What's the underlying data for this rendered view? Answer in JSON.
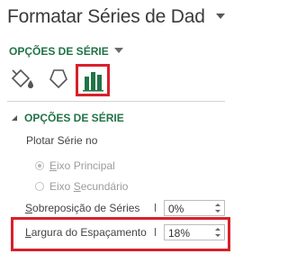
{
  "pane": {
    "title": "Formatar Séries de Dad"
  },
  "options_header": {
    "label": "OPÇÕES DE SÉRIE"
  },
  "tabs": {
    "fill_icon": "paint-bucket-icon",
    "effects_icon": "pentagon-icon",
    "series_icon": "bar-chart-icon",
    "accent_color": "#217346",
    "highlight_color": "#d8202b"
  },
  "section": {
    "label": "OPÇÕES DE SÉRIE",
    "plot_on_label": "Plotar Série no",
    "primary_axis_first": "E",
    "primary_axis_rest": "ixo Principal",
    "secondary_axis_first": "Eixo ",
    "secondary_axis_underlined": "S",
    "secondary_axis_rest": "ecundário",
    "overlap_underlined": "S",
    "overlap_rest": "obreposição de Séries",
    "overlap_value": "0%",
    "gap_underlined": "L",
    "gap_rest": "argura do Espaçamento",
    "gap_value": "18%"
  }
}
